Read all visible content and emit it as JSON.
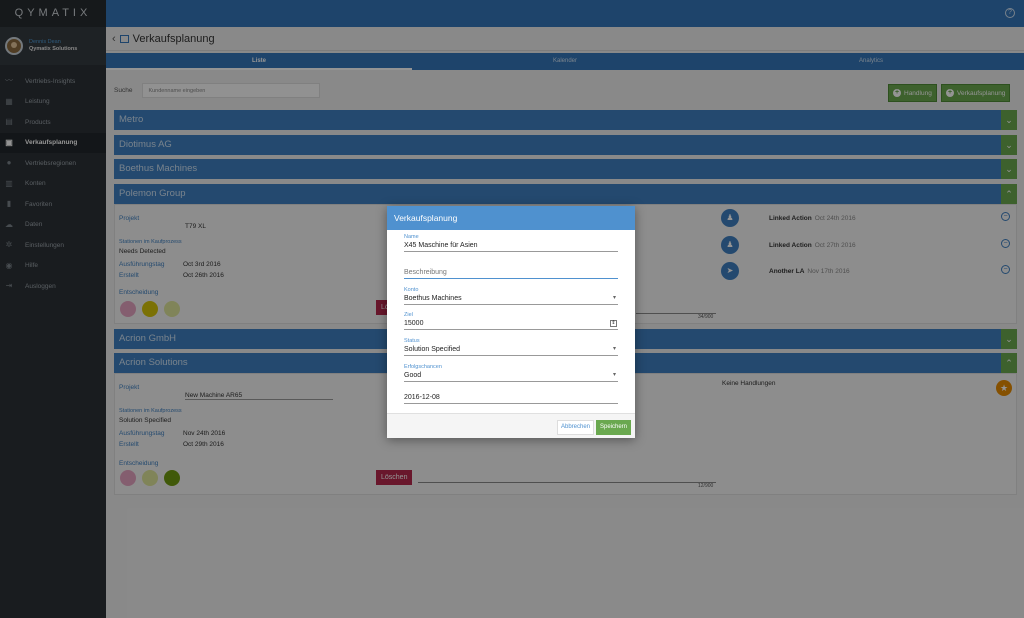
{
  "brand": "QYMATIX",
  "user": {
    "name": "Dennis Dean",
    "company": "Qymatix Solutions"
  },
  "nav": [
    {
      "label": "Vertriebs-Insights",
      "icon": "trend-icon"
    },
    {
      "label": "Leistung",
      "icon": "chart-icon"
    },
    {
      "label": "Products",
      "icon": "box-icon"
    },
    {
      "label": "Verkaufsplanung",
      "icon": "calendar-icon",
      "active": true
    },
    {
      "label": "Vertriebsregionen",
      "icon": "pin-icon"
    },
    {
      "label": "Konten",
      "icon": "building-icon"
    },
    {
      "label": "Favoriten",
      "icon": "bookmark-icon"
    },
    {
      "label": "Daten",
      "icon": "cloud-icon"
    },
    {
      "label": "Einstellungen",
      "icon": "gear-icon"
    },
    {
      "label": "Hilfe",
      "icon": "help-icon"
    },
    {
      "label": "Ausloggen",
      "icon": "logout-icon"
    }
  ],
  "header": {
    "title": "Verkaufsplanung",
    "help": "?"
  },
  "tabs": [
    "Liste",
    "Kalender",
    "Analytics"
  ],
  "search": {
    "label": "Suche",
    "placeholder": "Kundenname eingeben"
  },
  "buttons": {
    "handlung": "Handlung",
    "verkaufsplanung": "Verkaufsplanung"
  },
  "accounts": [
    "Metro",
    "Diotimus AG",
    "Boethus Machines",
    "Polemon Group",
    "Acrion GmbH",
    "Acrion Solutions"
  ],
  "polemon": {
    "projekt_label": "Projekt",
    "projekt": "T79 XL",
    "stage_label": "Stationen im Kaufprozess",
    "stage": "Needs Detected",
    "ausf_label": "Ausführungstag",
    "ausf": "Oct 3rd 2016",
    "erstellt_label": "Erstellt",
    "erstellt": "Oct 26th 2016",
    "entscheidung": "Entscheidung",
    "delete_partial": "Lö",
    "progress": "34/900",
    "actions": [
      {
        "title": "Linked Action",
        "date": "Oct 24th 2016"
      },
      {
        "title": "Linked Action",
        "date": "Oct 27th 2016"
      },
      {
        "title": "Another LA",
        "date": "Nov 17th 2016"
      }
    ]
  },
  "acrion": {
    "projekt_label": "Projekt",
    "projekt": "New Machine AR65",
    "stage_label": "Stationen im Kaufprozess",
    "stage": "Solution Specified",
    "ausf_label": "Ausführungstag",
    "ausf": "Nov 24th 2016",
    "erstellt_label": "Erstellt",
    "erstellt": "Oct 29th 2016",
    "entscheidung": "Entscheidung",
    "delete": "Löschen",
    "progress": "12/900",
    "no_actions": "Keine Handlungen"
  },
  "modal": {
    "title": "Verkaufsplanung",
    "name_label": "Name",
    "name": "X45 Maschine für Asien",
    "desc_placeholder": "Beschreibung",
    "konto_label": "Konto",
    "konto": "Boethus Machines",
    "ziel_label": "Ziel",
    "ziel": "15000",
    "status_label": "Status",
    "status": "Solution Specified",
    "chancen_label": "Erfolgschancen",
    "chancen": "Good",
    "date": "2016-12-08",
    "cancel": "Abbrechen",
    "save": "Speichern"
  },
  "colors": {
    "accent": "#3576b8",
    "green": "#6aa84f",
    "delete": "#b5294d",
    "pink": "#e3a3c0",
    "yellow": "#d4c30a",
    "light_yellow": "#dde39a",
    "dark_green": "#6f9a10",
    "star": "#e58a00"
  }
}
